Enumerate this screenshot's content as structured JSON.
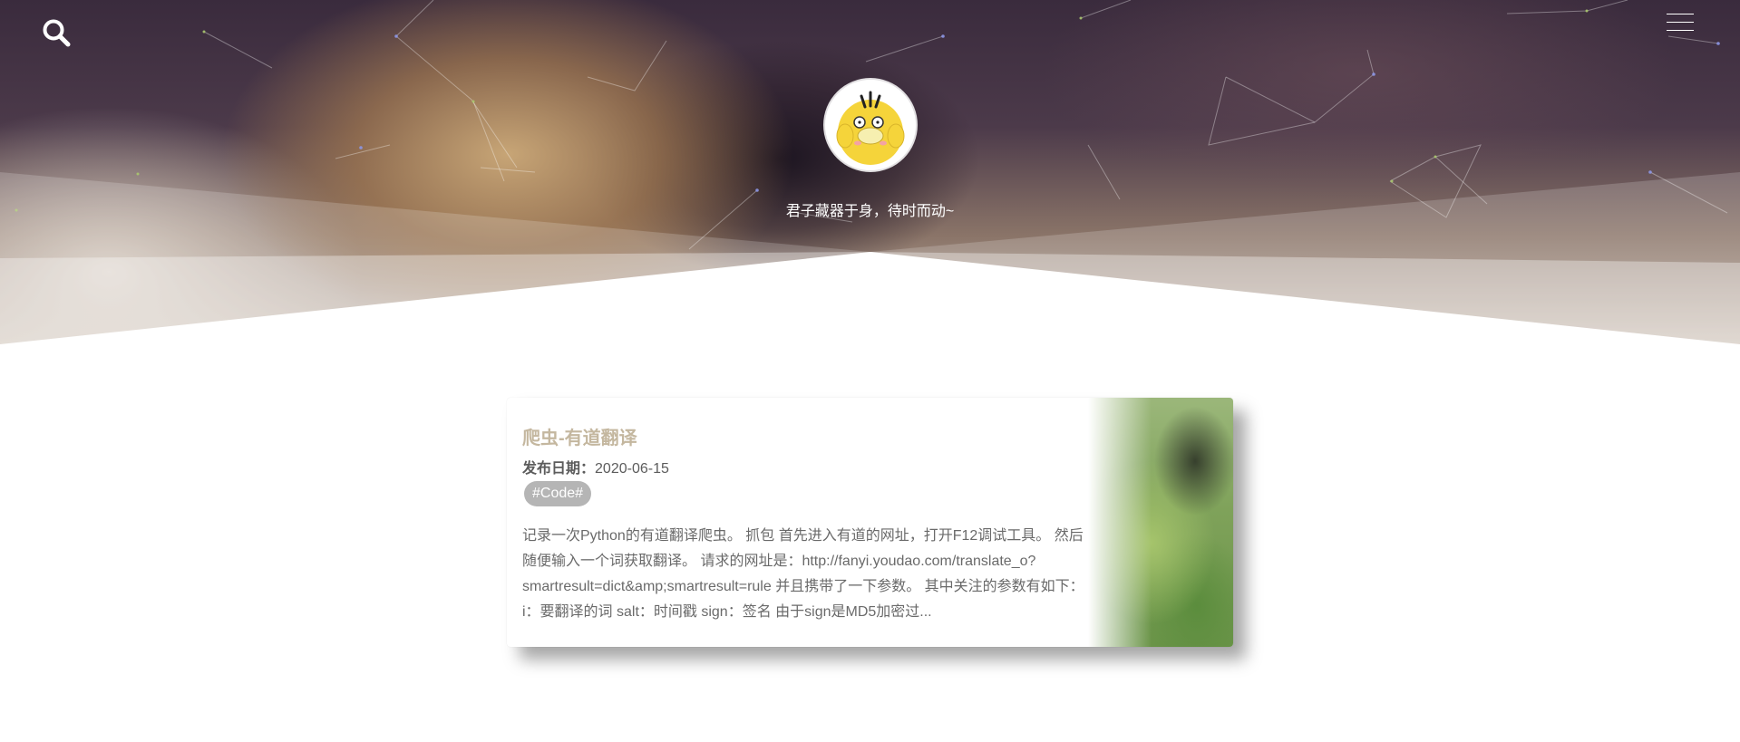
{
  "header": {
    "search_icon": "search-icon",
    "menu_icon": "hamburger-menu-icon",
    "avatar_icon": "psyduck-avatar",
    "motto": "君子藏器于身，待时而动~"
  },
  "posts": [
    {
      "title": "爬虫-有道翻译",
      "date_label": "发布日期：",
      "date": "2020-06-15",
      "tag": "#Code#",
      "summary": "记录一次Python的有道翻译爬虫。 抓包 首先进入有道的网址，打开F12调试工具。 然后随便输入一个词获取翻译。 请求的网址是：http://fanyi.youdao.com/translate_o?smartresult=dict&amp;smartresult=rule 并且携带了一下参数。 其中关注的参数有如下： i：要翻译的词 salt：时间戳 sign：签名 由于sign是MD5加密过..."
    }
  ],
  "colors": {
    "title": "#c4b79f",
    "tag_bg": "#b5b5b5",
    "text": "#6a6a6a"
  }
}
